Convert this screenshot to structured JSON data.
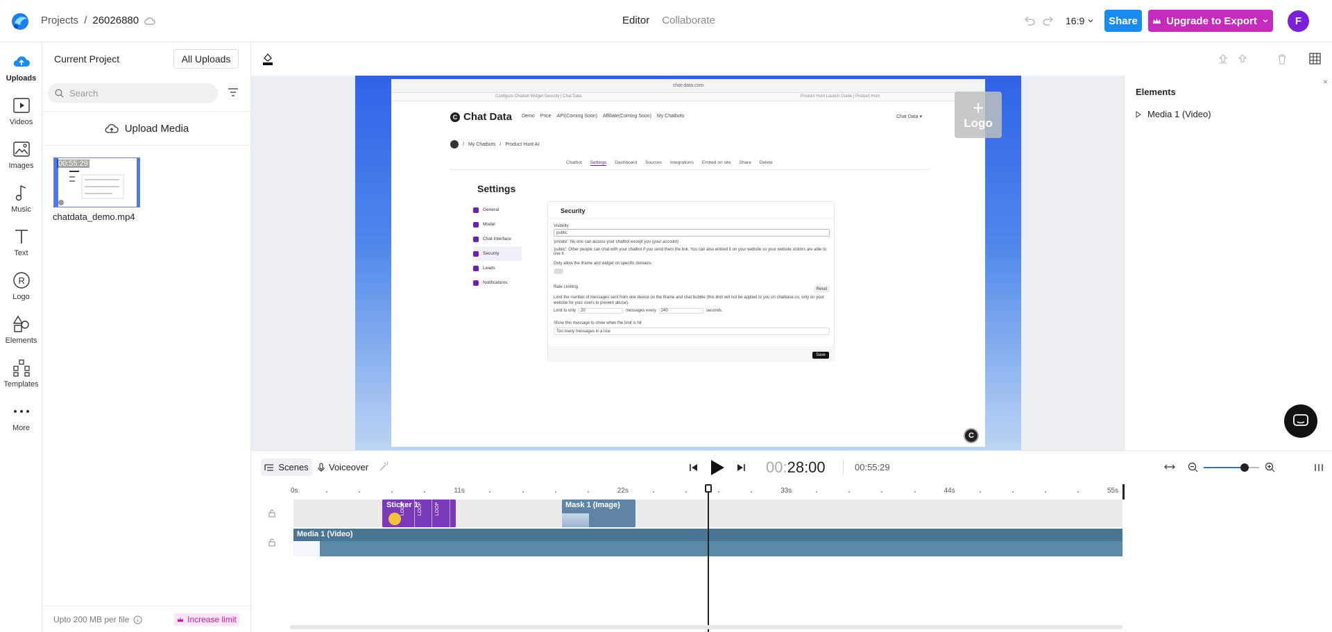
{
  "header": {
    "breadcrumb_root": "Projects",
    "breadcrumb_sep": "/",
    "project_id": "26026880",
    "mode_editor": "Editor",
    "mode_collaborate": "Collaborate",
    "aspect_ratio": "16:9",
    "share_label": "Share",
    "upgrade_label": "Upgrade to Export",
    "avatar_letter": "F"
  },
  "nav": {
    "items": [
      {
        "label": "Uploads",
        "icon": "upload-cloud-icon"
      },
      {
        "label": "Videos",
        "icon": "video-icon"
      },
      {
        "label": "Images",
        "icon": "image-icon"
      },
      {
        "label": "Music",
        "icon": "music-icon"
      },
      {
        "label": "Text",
        "icon": "text-icon"
      },
      {
        "label": "Logo",
        "icon": "logo-icon"
      },
      {
        "label": "Elements",
        "icon": "shapes-icon"
      },
      {
        "label": "Templates",
        "icon": "templates-icon"
      },
      {
        "label": "More",
        "icon": "more-icon"
      }
    ]
  },
  "uploads": {
    "title": "Current Project",
    "all_uploads": "All Uploads",
    "search_placeholder": "Search",
    "upload_media": "Upload Media",
    "file": {
      "duration": "00:55:29",
      "name": "chatdata_demo.mp4"
    },
    "limit_text": "Upto 200 MB per file",
    "increase_limit": "Increase limit"
  },
  "preview": {
    "url": "chat-data.com",
    "tab1": "Configure Chatbot Widget Security | Chat Data",
    "tab2": "Product Hunt Launch Guide | Product Hunt",
    "brand": "Chat Data",
    "topnav": [
      "Demo",
      "Price",
      "API(Coming Soon)",
      "Affiliate(Coming Soon)",
      "My Chatbots"
    ],
    "account_menu": "Chat Data ▾",
    "crumb1": "My Chatbots",
    "crumb2": "Product Hunt AI",
    "tabs": [
      "Chatbot",
      "Settings",
      "Dashboard",
      "Sources",
      "Integrations",
      "Embed on site",
      "Share",
      "Delete"
    ],
    "settings_title": "Settings",
    "settings_nav": [
      "General",
      "Model",
      "Chat Interface",
      "Security",
      "Leads",
      "Notifications"
    ],
    "card_title": "Security",
    "visibility_label": "Visibility",
    "visibility_value": "public",
    "private_note": "'private': No one can access your chatbot except you (your account)",
    "public_note": "'public': Other people can chat with your chatbot if you send them the link. You can also embed it on your website so your website visitors are able to use it.",
    "domains_label": "Only allow the iframe and widget on specific domains",
    "rate_label": "Rate Limiting",
    "reset_label": "Reset",
    "rate_note": "Limit the number of messages sent from one device on the iframe and chat bubble (this limit will not be applied to you on chatbase.co, only on your website for your users to prevent abuse).",
    "limit_prefix": "Limit to only",
    "limit_value": "20",
    "limit_mid": "messages every",
    "limit_seconds": "240",
    "limit_suffix": "seconds.",
    "message_label": "Show this message to show when the limit is hit",
    "message_value": "Too many messages in a row",
    "save_label": "Save",
    "logo_placeholder": "Logo",
    "badge_letter": "C"
  },
  "elements_panel": {
    "title": "Elements",
    "close": "×",
    "item": "Media 1 (Video)"
  },
  "timeline": {
    "scenes": "Scenes",
    "voiceover": "Voiceover",
    "current_time_dim": "00:",
    "current_time": "28:00",
    "total_time": "00:55:29",
    "ruler_labels": [
      "0s",
      "11s",
      "22s",
      "33s",
      "44s",
      "55s"
    ],
    "clips": {
      "sticker": "Sticker 1",
      "loop": "LOOP",
      "mask": "Mask 1 (Image)",
      "media": "Media 1 (Video)"
    },
    "zoom_level": 0.66,
    "playhead_time_s": 28
  },
  "colors": {
    "share_blue": "#1a8cf0",
    "upgrade_magenta": "#c72abf",
    "avatar_purple": "#7b1fd8",
    "sticker_purple": "#7a3ab8",
    "media_teal": "#5a89a8"
  }
}
